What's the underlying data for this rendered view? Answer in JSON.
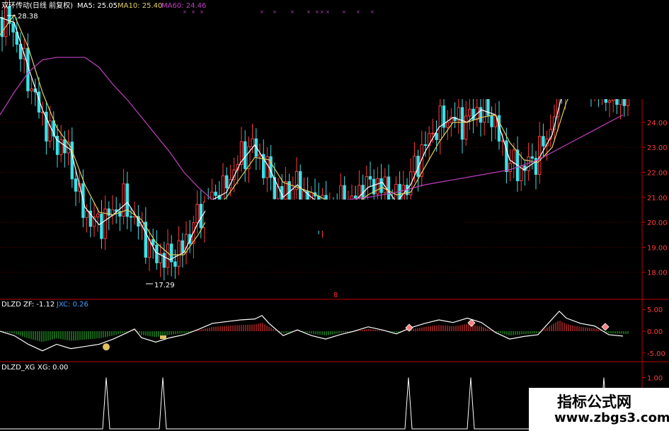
{
  "main": {
    "title": "双环传动(日线 前复权)",
    "ma5_label": "MA5: 25.05",
    "ma10_label": "MA10: 25.40",
    "ma60_label": "MA60: 24.46",
    "high_label": "28.38",
    "low_label": "17.29",
    "event_marker": "8"
  },
  "indicator1": {
    "name": "DLZD",
    "zf_label": "ZF: -1.12",
    "jxc_label": "JXC: 0.26"
  },
  "indicator2": {
    "name": "DLZD_XG",
    "xg_label": "XG: 0.00"
  },
  "watermark": {
    "text1": "指标公式网",
    "text2": "www.zbgs3.com"
  },
  "colors": {
    "up": "#ff3c3c",
    "down": "#3ce0e8",
    "ma5": "#ffffff",
    "ma10": "#e0d060",
    "ma60": "#c040c0",
    "jxc": "#40a0ff",
    "grid": "#6a0000"
  },
  "chart_data": [
    {
      "type": "candlestick",
      "title": "双环传动(日线 前复权)",
      "y_ticks": [
        "24.00",
        "23.00",
        "22.00",
        "21.00",
        "20.00",
        "19.00",
        "18.00"
      ],
      "ylim": [
        17.0,
        28.5
      ],
      "annotations": [
        {
          "label": "28.38",
          "type": "high"
        },
        {
          "label": "17.29",
          "type": "low"
        }
      ],
      "series": [
        {
          "name": "MA5",
          "points": [
            [
              0,
              28.2
            ],
            [
              20,
              28.0
            ],
            [
              40,
              26.2
            ],
            [
              60,
              24.5
            ],
            [
              80,
              23.3
            ],
            [
              100,
              22.9
            ],
            [
              120,
              20.6
            ],
            [
              140,
              19.9
            ],
            [
              160,
              20.3
            ],
            [
              180,
              20.8
            ],
            [
              200,
              19.9
            ],
            [
              220,
              18.8
            ],
            [
              240,
              18.5
            ],
            [
              260,
              18.8
            ],
            [
              280,
              20.0
            ],
            [
              300,
              20.9
            ],
            [
              320,
              21.2
            ],
            [
              340,
              22.4
            ],
            [
              360,
              23.1
            ],
            [
              380,
              22.2
            ],
            [
              400,
              21.0
            ],
            [
              420,
              21.5
            ],
            [
              440,
              21.0
            ],
            [
              460,
              20.6
            ],
            [
              500,
              20.8
            ],
            [
              520,
              21.4
            ],
            [
              540,
              21.6
            ],
            [
              560,
              20.8
            ],
            [
              580,
              21.5
            ],
            [
              600,
              22.8
            ],
            [
              620,
              23.8
            ],
            [
              640,
              24.2
            ],
            [
              660,
              24.0
            ],
            [
              680,
              24.5
            ],
            [
              700,
              24.3
            ],
            [
              720,
              22.5
            ],
            [
              740,
              22.1
            ],
            [
              760,
              22.5
            ],
            [
              780,
              23.5
            ],
            [
              800,
              25.8
            ],
            [
              820,
              26.5
            ],
            [
              840,
              25.6
            ],
            [
              860,
              25.2
            ],
            [
              880,
              25.0
            ]
          ]
        },
        {
          "name": "MA10",
          "points": [
            [
              0,
              27.5
            ],
            [
              20,
              28.3
            ],
            [
              40,
              27.0
            ],
            [
              60,
              25.2
            ],
            [
              80,
              23.8
            ],
            [
              100,
              23.0
            ],
            [
              120,
              21.5
            ],
            [
              140,
              20.4
            ],
            [
              160,
              20.3
            ],
            [
              180,
              20.5
            ],
            [
              200,
              20.1
            ],
            [
              220,
              19.2
            ],
            [
              240,
              18.7
            ],
            [
              260,
              18.7
            ],
            [
              280,
              19.5
            ],
            [
              300,
              20.5
            ],
            [
              320,
              21.0
            ],
            [
              340,
              21.8
            ],
            [
              360,
              22.6
            ],
            [
              380,
              22.5
            ],
            [
              400,
              21.6
            ],
            [
              420,
              21.4
            ],
            [
              440,
              21.2
            ],
            [
              460,
              20.9
            ],
            [
              500,
              20.7
            ],
            [
              520,
              21.1
            ],
            [
              540,
              21.4
            ],
            [
              560,
              21.1
            ],
            [
              580,
              21.2
            ],
            [
              600,
              22.2
            ],
            [
              620,
              23.2
            ],
            [
              640,
              24.0
            ],
            [
              660,
              24.0
            ],
            [
              680,
              24.2
            ],
            [
              700,
              24.3
            ],
            [
              720,
              23.2
            ],
            [
              740,
              22.5
            ],
            [
              760,
              22.4
            ],
            [
              780,
              23.0
            ],
            [
              800,
              24.8
            ],
            [
              820,
              26.0
            ],
            [
              840,
              25.9
            ],
            [
              860,
              25.5
            ],
            [
              880,
              25.4
            ]
          ]
        },
        {
          "name": "MA60",
          "points": [
            [
              0,
              24.3
            ],
            [
              20,
              25.2
            ],
            [
              40,
              26.0
            ],
            [
              60,
              26.5
            ],
            [
              80,
              26.6
            ],
            [
              100,
              26.6
            ],
            [
              120,
              26.6
            ],
            [
              140,
              26.2
            ],
            [
              160,
              25.5
            ],
            [
              180,
              24.9
            ],
            [
              200,
              24.2
            ],
            [
              220,
              23.5
            ],
            [
              240,
              22.8
            ],
            [
              260,
              22.0
            ],
            [
              280,
              21.4
            ],
            [
              300,
              20.9
            ],
            [
              340,
              20.8
            ],
            [
              400,
              20.8
            ],
            [
              460,
              20.8
            ],
            [
              520,
              21.0
            ],
            [
              560,
              21.2
            ],
            [
              600,
              21.5
            ],
            [
              640,
              21.7
            ],
            [
              680,
              21.9
            ],
            [
              720,
              22.1
            ],
            [
              760,
              22.5
            ],
            [
              800,
              23.1
            ],
            [
              840,
              23.7
            ],
            [
              880,
              24.3
            ]
          ]
        }
      ]
    },
    {
      "type": "line",
      "title": "DLZD",
      "y_ticks": [
        "5.00",
        "0.00",
        "-5.00"
      ],
      "ylim": [
        -6.5,
        6.5
      ],
      "series": [
        {
          "name": "ZF",
          "points": [
            [
              0,
              0.0
            ],
            [
              20,
              -1.0
            ],
            [
              40,
              -3.0
            ],
            [
              60,
              -4.5
            ],
            [
              80,
              -3.0
            ],
            [
              100,
              -4.0
            ],
            [
              120,
              -3.5
            ],
            [
              140,
              -3.0
            ],
            [
              160,
              -1.8
            ],
            [
              180,
              -0.3
            ],
            [
              190,
              0.5
            ],
            [
              200,
              -1.5
            ],
            [
              220,
              -2.5
            ],
            [
              240,
              -1.5
            ],
            [
              260,
              -0.8
            ],
            [
              280,
              0.4
            ],
            [
              300,
              1.8
            ],
            [
              320,
              2.2
            ],
            [
              340,
              2.6
            ],
            [
              360,
              2.8
            ],
            [
              370,
              3.6
            ],
            [
              380,
              1.8
            ],
            [
              400,
              -1.0
            ],
            [
              420,
              0.3
            ],
            [
              440,
              -1.0
            ],
            [
              460,
              -1.8
            ],
            [
              480,
              -0.8
            ],
            [
              500,
              0.0
            ],
            [
              520,
              1.0
            ],
            [
              540,
              0.3
            ],
            [
              560,
              -0.6
            ],
            [
              580,
              0.8
            ],
            [
              600,
              1.8
            ],
            [
              620,
              2.6
            ],
            [
              640,
              2.0
            ],
            [
              660,
              3.0
            ],
            [
              680,
              2.0
            ],
            [
              700,
              -0.3
            ],
            [
              720,
              -1.8
            ],
            [
              740,
              -1.2
            ],
            [
              760,
              -0.8
            ],
            [
              780,
              2.8
            ],
            [
              790,
              4.6
            ],
            [
              800,
              3.0
            ],
            [
              820,
              1.8
            ],
            [
              840,
              1.2
            ],
            [
              860,
              -0.8
            ],
            [
              880,
              -1.12
            ]
          ]
        }
      ],
      "markers": [
        "$",
        "☞",
        "◆",
        "◆",
        "◆"
      ]
    },
    {
      "type": "line",
      "title": "DLZD_XG",
      "y_ticks": [
        "1.00",
        "0.50"
      ],
      "ylim": [
        0,
        1.2
      ],
      "series": [
        {
          "name": "XG",
          "spikes_at": [
            150,
            230,
            577,
            665,
            853
          ]
        }
      ]
    }
  ]
}
